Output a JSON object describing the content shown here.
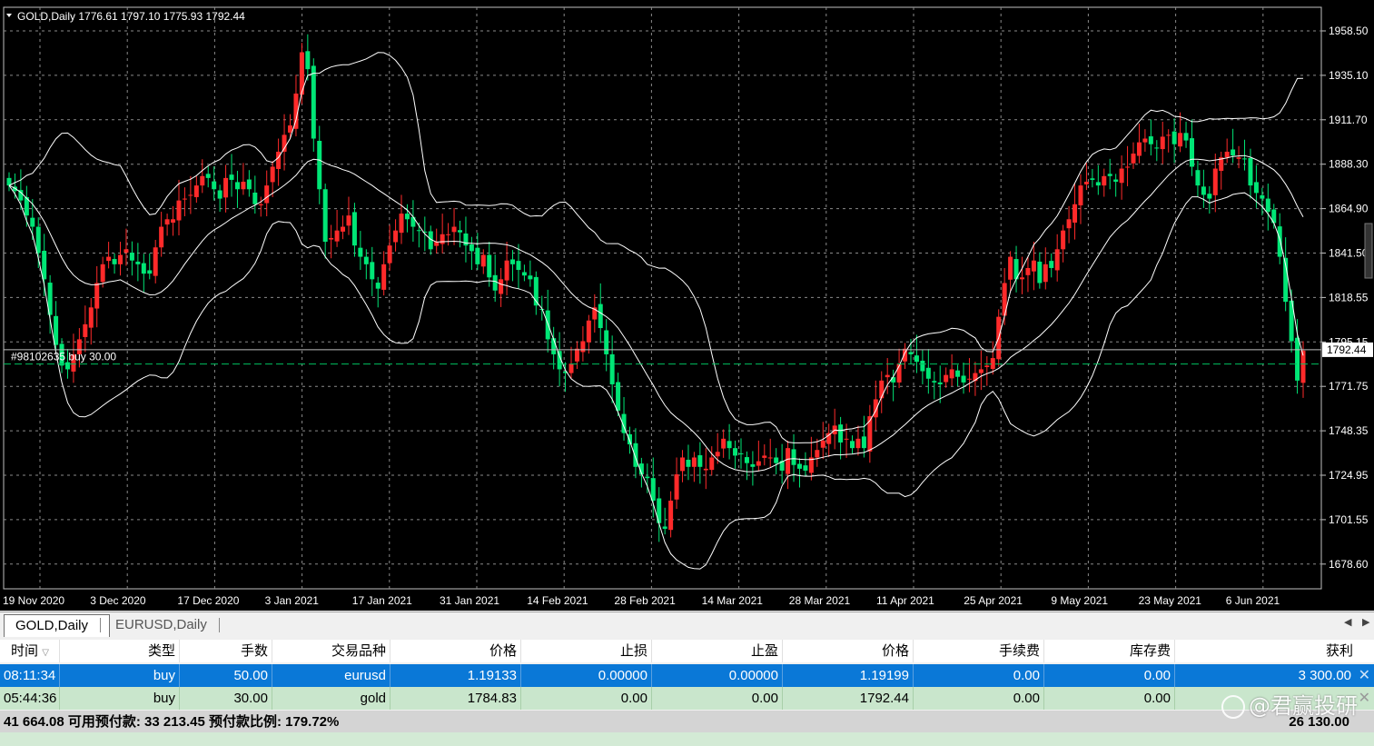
{
  "chart": {
    "header": "GOLD,Daily  1776.61 1797.10 1775.93 1792.44",
    "order_line_label": "#98102635 buy 30.00",
    "current_price_label": "1792.44",
    "price_ticks": [
      "1958.50",
      "1935.10",
      "1911.70",
      "1888.30",
      "1864.90",
      "1841.50",
      "1818.55",
      "1795.15",
      "1771.75",
      "1748.35",
      "1724.95",
      "1701.55",
      "1678.60"
    ],
    "date_ticks": [
      "19 Nov 2020",
      "3 Dec 2020",
      "17 Dec 2020",
      "3 Jan 2021",
      "17 Jan 2021",
      "31 Jan 2021",
      "14 Feb 2021",
      "28 Feb 2021",
      "14 Mar 2021",
      "28 Mar 2021",
      "11 Apr 2021",
      "25 Apr 2021",
      "9 May 2021",
      "23 May 2021",
      "6 Jun 2021"
    ],
    "colors": {
      "bull": "#ff2a2a",
      "bear": "#00e676",
      "grid": "#8a8a8a",
      "band": "#ffffff",
      "bg": "#000000"
    }
  },
  "chart_data": {
    "type": "candlestick",
    "title": "GOLD,Daily",
    "ylim": [
      1665,
      1975
    ],
    "close_series": [
      1880,
      1877,
      1872,
      1864,
      1858,
      1844,
      1830,
      1811,
      1795,
      1784,
      1782,
      1790,
      1798,
      1806,
      1815,
      1828,
      1838,
      1842,
      1838,
      1843,
      1846,
      1840,
      1838,
      1833,
      1833,
      1847,
      1858,
      1862,
      1862,
      1872,
      1873,
      1875,
      1880,
      1885,
      1884,
      1878,
      1873,
      1884,
      1883,
      1878,
      1882,
      1878,
      1870,
      1870,
      1880,
      1890,
      1898,
      1907,
      1912,
      1929,
      1951,
      1942,
      1905,
      1878,
      1850,
      1852,
      1856,
      1858,
      1864,
      1848,
      1842,
      1838,
      1830,
      1825,
      1838,
      1848,
      1856,
      1865,
      1862,
      1858,
      1856,
      1855,
      1846,
      1850,
      1854,
      1854,
      1858,
      1855,
      1848,
      1845,
      1838,
      1843,
      1831,
      1824,
      1830,
      1840,
      1838,
      1835,
      1832,
      1830,
      1816,
      1814,
      1798,
      1790,
      1782,
      1780,
      1785,
      1793,
      1797,
      1808,
      1815,
      1804,
      1790,
      1774,
      1760,
      1748,
      1742,
      1730,
      1726,
      1724,
      1712,
      1700,
      1697,
      1712,
      1726,
      1735,
      1730,
      1735,
      1730,
      1729,
      1735,
      1738,
      1745,
      1740,
      1736,
      1737,
      1732,
      1730,
      1733,
      1736,
      1735,
      1732,
      1728,
      1740,
      1731,
      1729,
      1728,
      1735,
      1739,
      1744,
      1748,
      1752,
      1743,
      1745,
      1740,
      1745,
      1740,
      1757,
      1766,
      1776,
      1779,
      1775,
      1785,
      1793,
      1790,
      1786,
      1781,
      1777,
      1775,
      1774,
      1779,
      1782,
      1778,
      1775,
      1777,
      1780,
      1782,
      1784,
      1788,
      1810,
      1828,
      1842,
      1830,
      1831,
      1836,
      1840,
      1828,
      1838,
      1836,
      1846,
      1856,
      1862,
      1870,
      1880,
      1882,
      1883,
      1880,
      1885,
      1885,
      1882,
      1889,
      1890,
      1897,
      1903,
      1905,
      1902,
      1900,
      1906,
      1907,
      1902,
      1908,
      1904,
      1890,
      1880,
      1875,
      1873,
      1889,
      1895,
      1898,
      1896,
      1895,
      1894,
      1880,
      1876,
      1873,
      1866,
      1860,
      1842,
      1818,
      1797,
      1776,
      1792
    ]
  },
  "tabs": {
    "tab1": "GOLD,Daily",
    "tab2": "EURUSD,Daily"
  },
  "table": {
    "headers": [
      "时间",
      "类型",
      "手数",
      "交易品种",
      "价格",
      "止损",
      "止盈",
      "价格",
      "手续费",
      "库存费",
      "获利"
    ],
    "rows": [
      [
        "08:11:34",
        "buy",
        "50.00",
        "eurusd",
        "1.19133",
        "0.00000",
        "0.00000",
        "1.19199",
        "0.00",
        "0.00",
        "3 300.00"
      ],
      [
        "05:44:36",
        "buy",
        "30.00",
        "gold",
        "1784.83",
        "0.00",
        "0.00",
        "1792.44",
        "0.00",
        "0.00",
        ""
      ]
    ],
    "summary_left": "41 664.08  可用预付款: 33 213.45  预付款比例: 179.72%",
    "summary_right": "26 130.00"
  },
  "watermark": "@君赢投研"
}
